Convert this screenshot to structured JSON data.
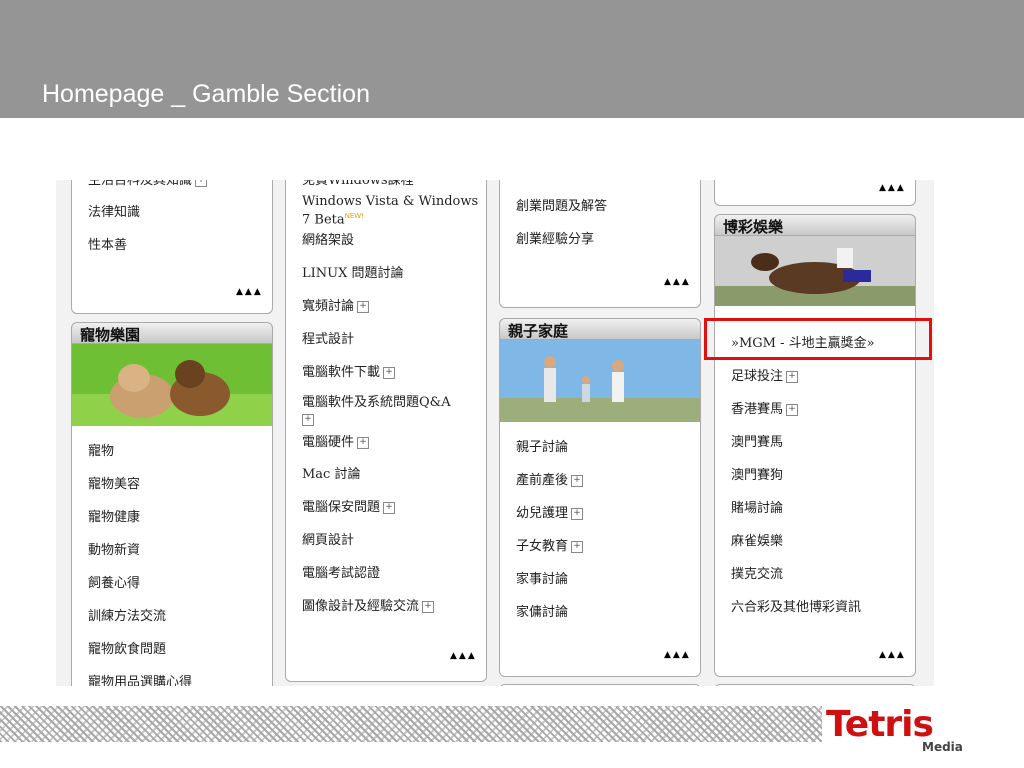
{
  "slide": {
    "title": "Homepage _ Gamble Section",
    "logo_main": "Tetris",
    "logo_sub": "Media"
  },
  "more_label": "▲▲▲",
  "plus_label": "+",
  "col1": {
    "top_items": [
      "生活百科及其知識",
      "法律知識",
      "性本善"
    ],
    "pets": {
      "header": "寵物樂園",
      "items": [
        "寵物",
        "寵物美容",
        "寵物健康",
        "動物新資",
        "飼養心得",
        "訓練方法交流",
        "寵物飲食問題",
        "寵物用品選購心得"
      ]
    }
  },
  "col2": {
    "items": [
      "免費Windows課程",
      "Windows Vista & Windows 7 Beta",
      "網絡架設",
      "LINUX 問題討論",
      "寬頻討論",
      "程式設計",
      "電腦軟件下載",
      "電腦軟件及系統問題Q&A",
      "電腦硬件",
      "Mac 討論",
      "電腦保安問題",
      "網頁設計",
      "電腦考試認證",
      "圖像設計及經驗交流"
    ],
    "new_badge": "NEW!"
  },
  "col3": {
    "top_items": [
      "創業問題及解答",
      "創業經驗分享"
    ],
    "family": {
      "header": "親子家庭",
      "items": [
        "親子討論",
        "產前產後",
        "幼兒護理",
        "子女教育",
        "家事討論",
        "家傭討論"
      ]
    }
  },
  "col4": {
    "gamble": {
      "header": "博彩娛樂",
      "items": [
        "»MGM - 斗地主贏獎金»",
        "足球投注",
        "香港賽馬",
        "澳門賽馬",
        "澳門賽狗",
        "賭場討論",
        "麻雀娛樂",
        "撲克交流",
        "六合彩及其他博彩資訊"
      ]
    }
  },
  "colors": {
    "highlight": "#e01010",
    "topbar": "#959595",
    "logo": "#cf1010"
  }
}
